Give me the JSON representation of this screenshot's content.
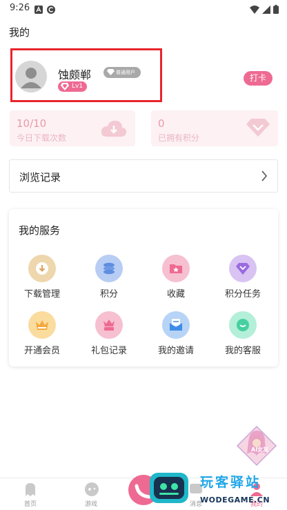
{
  "status_bar": {
    "time": "9:26",
    "icons": [
      "notification-a-icon",
      "app-c-icon",
      "wifi-icon",
      "signal-icon",
      "battery-icon"
    ]
  },
  "page": {
    "title": "我的"
  },
  "profile": {
    "username": "蚀颇郸",
    "member_badge": "普通用户",
    "level": "Lv1",
    "checkin_label": "打卡"
  },
  "stats": {
    "downloads": {
      "value": "10/10",
      "label": "今日下载次数",
      "icon": "cloud-download-icon"
    },
    "points": {
      "value": "0",
      "label": "已拥有积分",
      "icon": "diamond-icon"
    }
  },
  "history": {
    "label": "浏览记录"
  },
  "services": {
    "title": "我的服务",
    "items": [
      {
        "label": "下载管理",
        "icon": "download-icon",
        "color": "#e6b97d"
      },
      {
        "label": "积分",
        "icon": "coins-icon",
        "color": "#7aa4e8"
      },
      {
        "label": "收藏",
        "icon": "folder-star-icon",
        "color": "#ee6a92"
      },
      {
        "label": "积分任务",
        "icon": "diamond-task-icon",
        "color": "#a77be4"
      },
      {
        "label": "开通会员",
        "icon": "crown-icon",
        "color": "#f4a93d"
      },
      {
        "label": "礼包记录",
        "icon": "gift-crown-icon",
        "color": "#ee6a92"
      },
      {
        "label": "我的邀请",
        "icon": "mail-icon",
        "color": "#3e8de8"
      },
      {
        "label": "我的客服",
        "icon": "chat-icon",
        "color": "#46cfa1"
      }
    ]
  },
  "bottom_nav": {
    "items": [
      {
        "label": "首页",
        "icon": "ghost-icon"
      },
      {
        "label": "游戏",
        "icon": "gamepad-icon"
      },
      {
        "label": "",
        "icon": "center-icon"
      },
      {
        "label": "消息",
        "icon": "message-icon"
      },
      {
        "label": "我的",
        "icon": "user-icon"
      }
    ]
  },
  "ai_float": {
    "label": "AI女友",
    "icon": "ai-girlfriend-icon"
  },
  "watermark": {
    "cn": "玩客驿站",
    "en": "WODEGAME.CN"
  },
  "colors": {
    "accent": "#ee6a92",
    "highlight_border": "#e8242c",
    "card_bg": "#fdf1f3"
  }
}
